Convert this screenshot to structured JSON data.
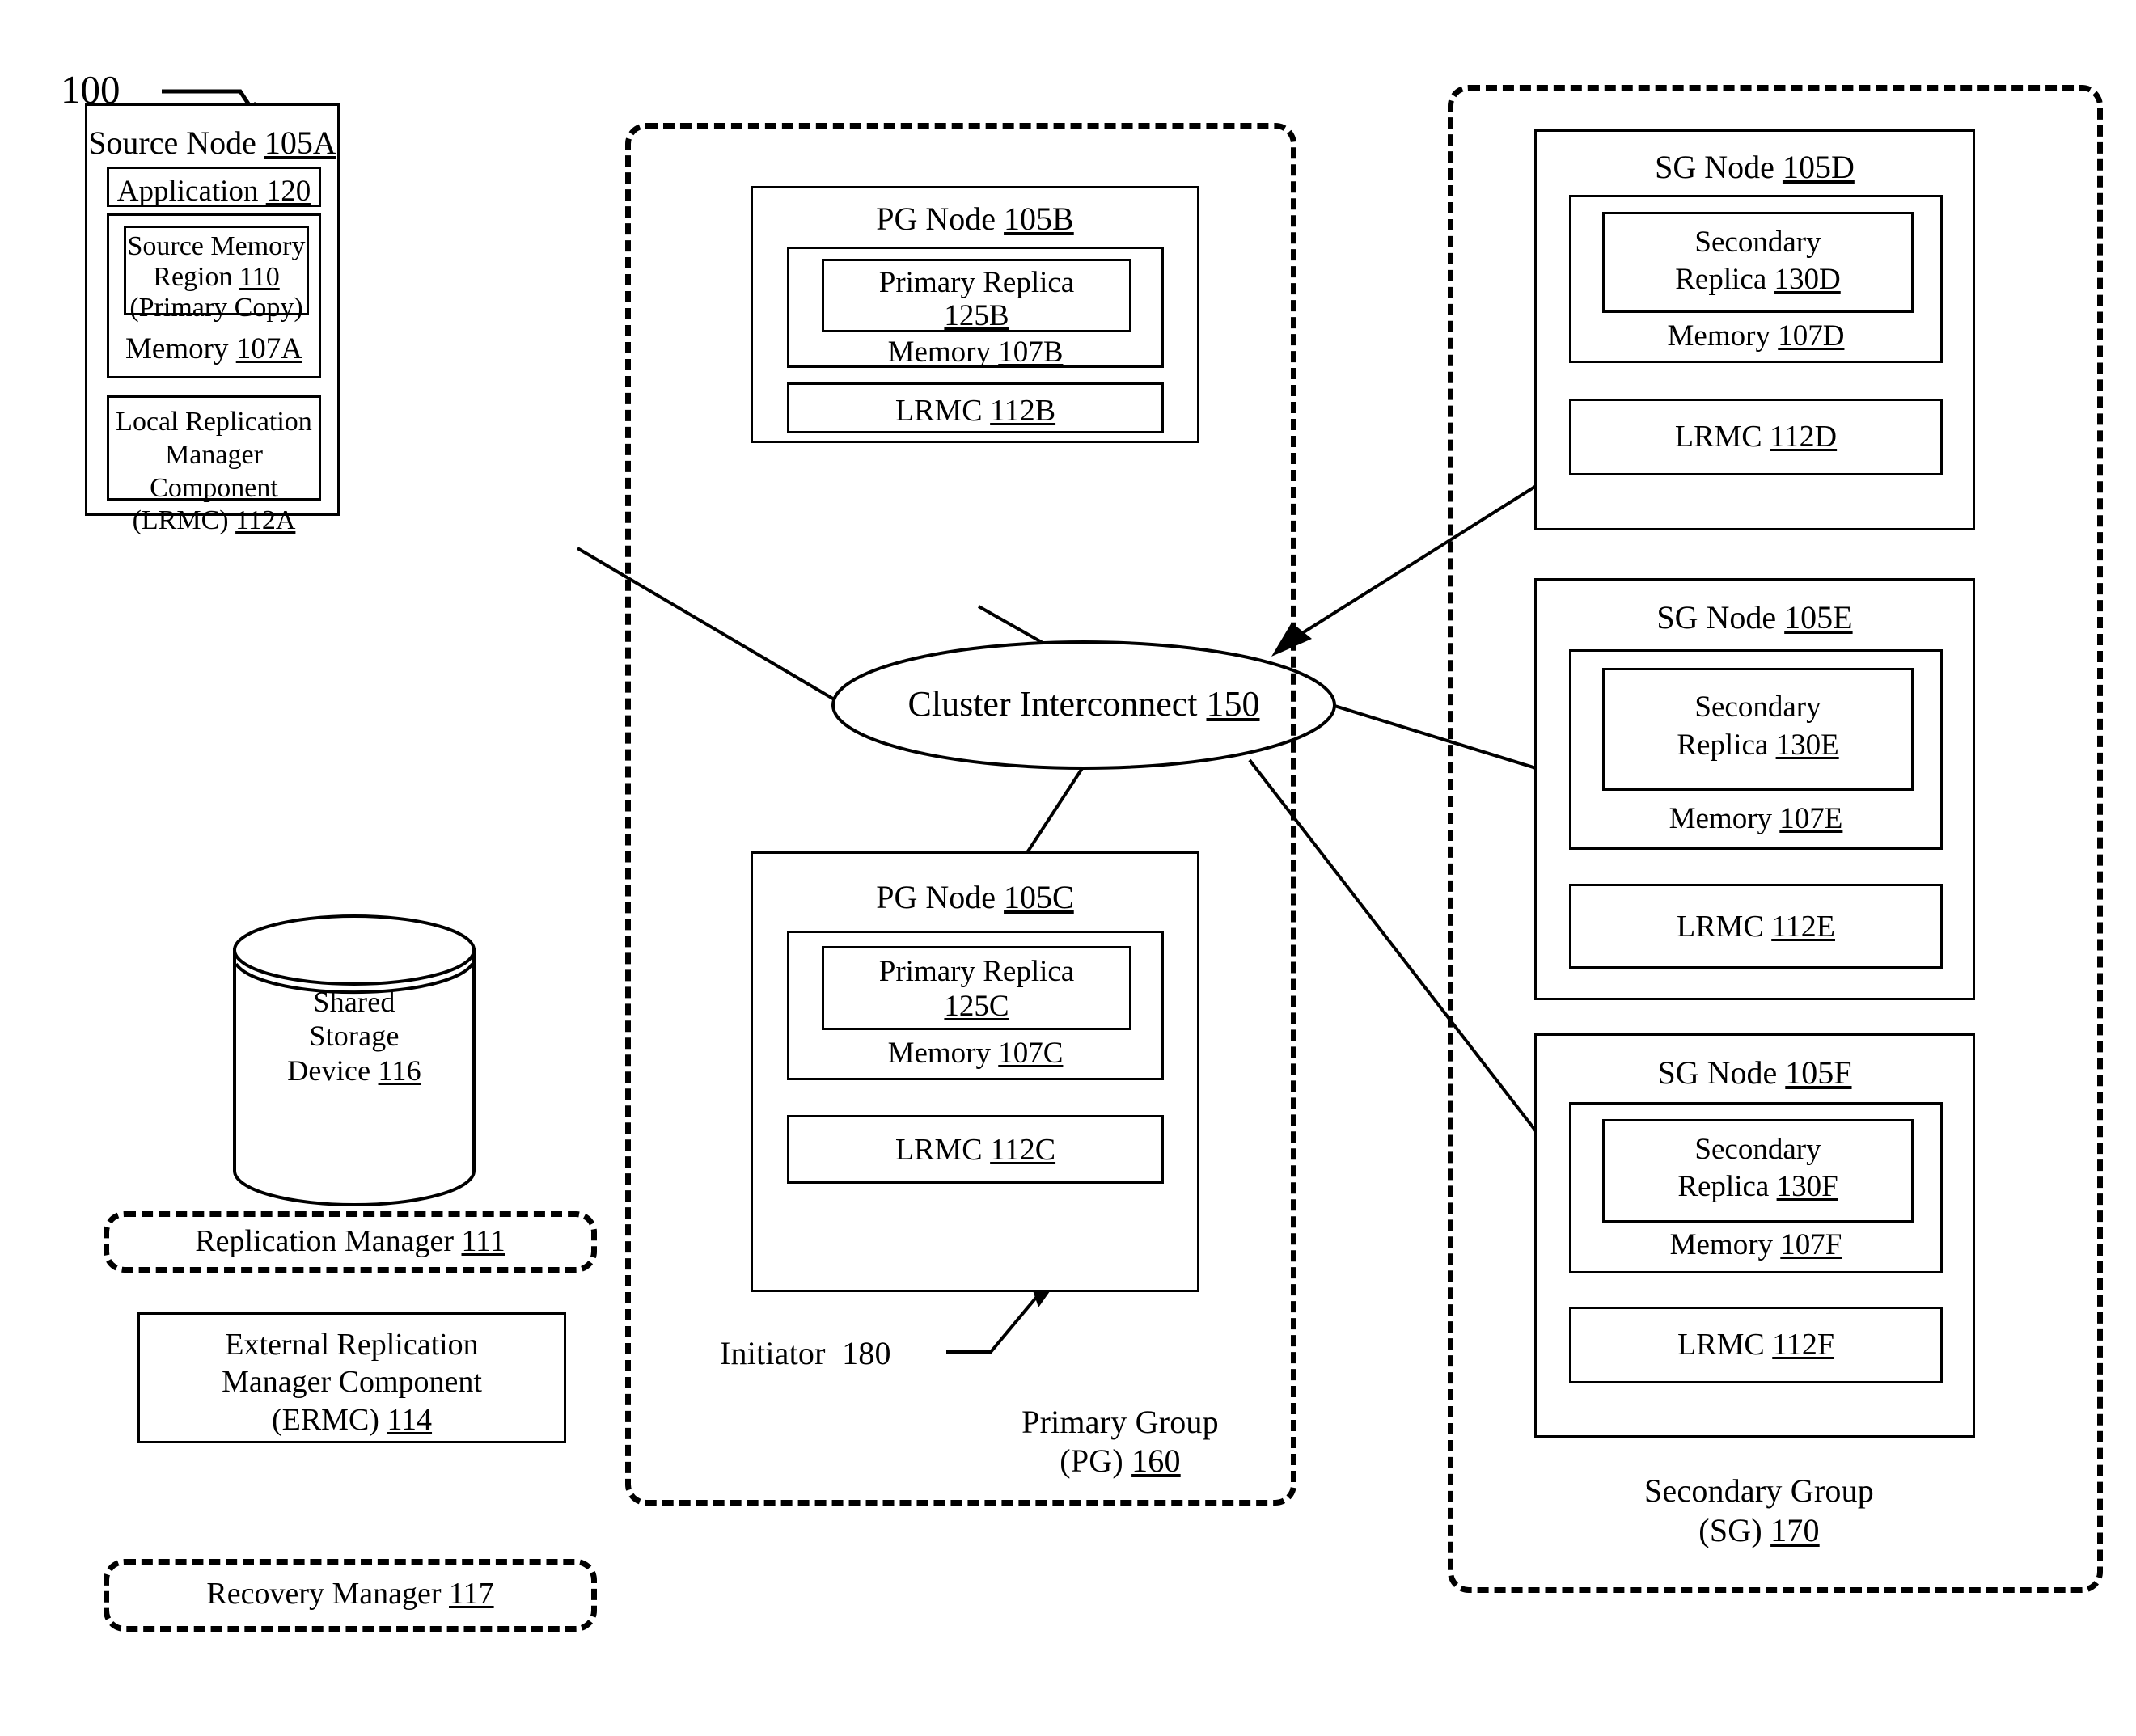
{
  "figure": {
    "reference_number": "100"
  },
  "source_node": {
    "title": "Source Node ",
    "title_ref": "105A",
    "application": {
      "label": "Application ",
      "ref": "120"
    },
    "source_memory_region": {
      "line1": "Source Memory",
      "line2": "Region ",
      "line2_ref": "110",
      "line3": "(Primary Copy)"
    },
    "memory": {
      "label": "Memory ",
      "ref": "107A"
    },
    "lrmc": {
      "line1": "Local Replication",
      "line2": "Manager  Component",
      "line3": "(LRMC)  ",
      "line3_ref": "112A"
    }
  },
  "shared_storage": {
    "line1": "Shared",
    "line2": "Storage",
    "line3": "Device ",
    "line3_ref": "116"
  },
  "replication_manager": {
    "label": "Replication Manager ",
    "ref": "111"
  },
  "ermc": {
    "line1": "External Replication",
    "line2": "Manager  Component",
    "line3": "(ERMC)  ",
    "line3_ref": "114"
  },
  "recovery_manager": {
    "label": "Recovery Manager ",
    "ref": "117"
  },
  "primary_group": {
    "group_label_line1": "Primary Group",
    "group_label_line2": "(PG) ",
    "group_label_ref": "160",
    "initiator": {
      "label": "Initiator  ",
      "ref": "180"
    },
    "nodes": [
      {
        "title": "PG Node ",
        "title_ref": "105B",
        "replica_line1": "Primary Replica",
        "replica_ref": "125B",
        "memory_label": "Memory ",
        "memory_ref": "107B",
        "lrmc_label": "LRMC  ",
        "lrmc_ref": "112B"
      },
      {
        "title": "PG Node ",
        "title_ref": "105C",
        "replica_line1": "Primary Replica",
        "replica_ref": "125C",
        "memory_label": "Memory ",
        "memory_ref": "107C",
        "lrmc_label": "LRMC  ",
        "lrmc_ref": "112C"
      }
    ]
  },
  "cluster_interconnect": {
    "label": "Cluster Interconnect ",
    "ref": "150"
  },
  "secondary_group": {
    "group_label_line1": "Secondary Group",
    "group_label_line2": "(SG) ",
    "group_label_ref": "170",
    "nodes": [
      {
        "title": "SG Node ",
        "title_ref": "105D",
        "replica_line1": "Secondary",
        "replica_line2": "Replica  ",
        "replica_ref": "130D",
        "memory_label": "Memory ",
        "memory_ref": "107D",
        "lrmc_label": "LRMC  ",
        "lrmc_ref": "112D"
      },
      {
        "title": "SG Node ",
        "title_ref": "105E",
        "replica_line1": "Secondary",
        "replica_line2": "Replica  ",
        "replica_ref": "130E",
        "memory_label": "Memory ",
        "memory_ref": "107E",
        "lrmc_label": "LRMC  ",
        "lrmc_ref": "112E"
      },
      {
        "title": "SG Node ",
        "title_ref": "105F",
        "replica_line1": "Secondary",
        "replica_line2": "Replica  ",
        "replica_ref": "130F",
        "memory_label": "Memory ",
        "memory_ref": "107F",
        "lrmc_label": "LRMC  ",
        "lrmc_ref": "112F"
      }
    ]
  },
  "colors": {
    "line": "#000000",
    "background": "#ffffff"
  }
}
